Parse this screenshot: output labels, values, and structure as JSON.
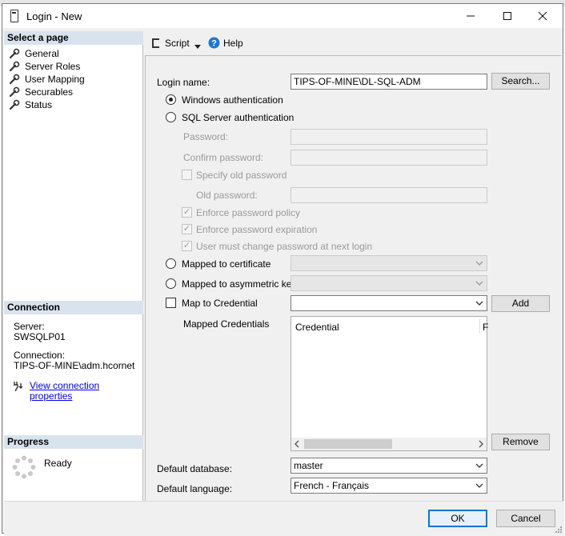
{
  "window": {
    "title": "Login - New"
  },
  "sidebar": {
    "select_page_header": "Select a page",
    "pages": [
      {
        "label": "General"
      },
      {
        "label": "Server Roles"
      },
      {
        "label": "User Mapping"
      },
      {
        "label": "Securables"
      },
      {
        "label": "Status"
      }
    ],
    "connection_header": "Connection",
    "server_label": "Server:",
    "server_value": "SWSQLP01",
    "connection_label": "Connection:",
    "connection_value": "TIPS-OF-MINE\\adm.hcornet",
    "view_connection_link": "View connection properties",
    "progress_header": "Progress",
    "progress_status": "Ready"
  },
  "toolbar": {
    "script_label": "Script",
    "help_label": "Help"
  },
  "form": {
    "login_name_label": "Login name:",
    "login_name_value": "TIPS-OF-MINE\\DL-SQL-ADM",
    "search_button": "Search...",
    "windows_auth_label": "Windows authentication",
    "sql_auth_label": "SQL Server authentication",
    "password_label": "Password:",
    "confirm_password_label": "Confirm password:",
    "specify_old_password_label": "Specify old password",
    "old_password_label": "Old password:",
    "enforce_policy_label": "Enforce password policy",
    "enforce_expiration_label": "Enforce password expiration",
    "must_change_label": "User must change password at next login",
    "mapped_certificate_label": "Mapped to certificate",
    "mapped_asymmetric_label": "Mapped to asymmetric key",
    "map_credential_label": "Map to Credential",
    "add_button": "Add",
    "mapped_credentials_label": "Mapped Credentials",
    "credential_column": "Credential",
    "provider_column_partial": "F",
    "remove_button": "Remove",
    "default_database_label": "Default database:",
    "default_database_value": "master",
    "default_language_label": "Default language:",
    "default_language_value": "French - Français"
  },
  "footer": {
    "ok_button": "OK",
    "cancel_button": "Cancel"
  },
  "colors": {
    "section_header_bg": "#d9e3ee",
    "link": "#0000ee",
    "ok_border": "#0078d7",
    "help_icon": "#1e78d2"
  }
}
